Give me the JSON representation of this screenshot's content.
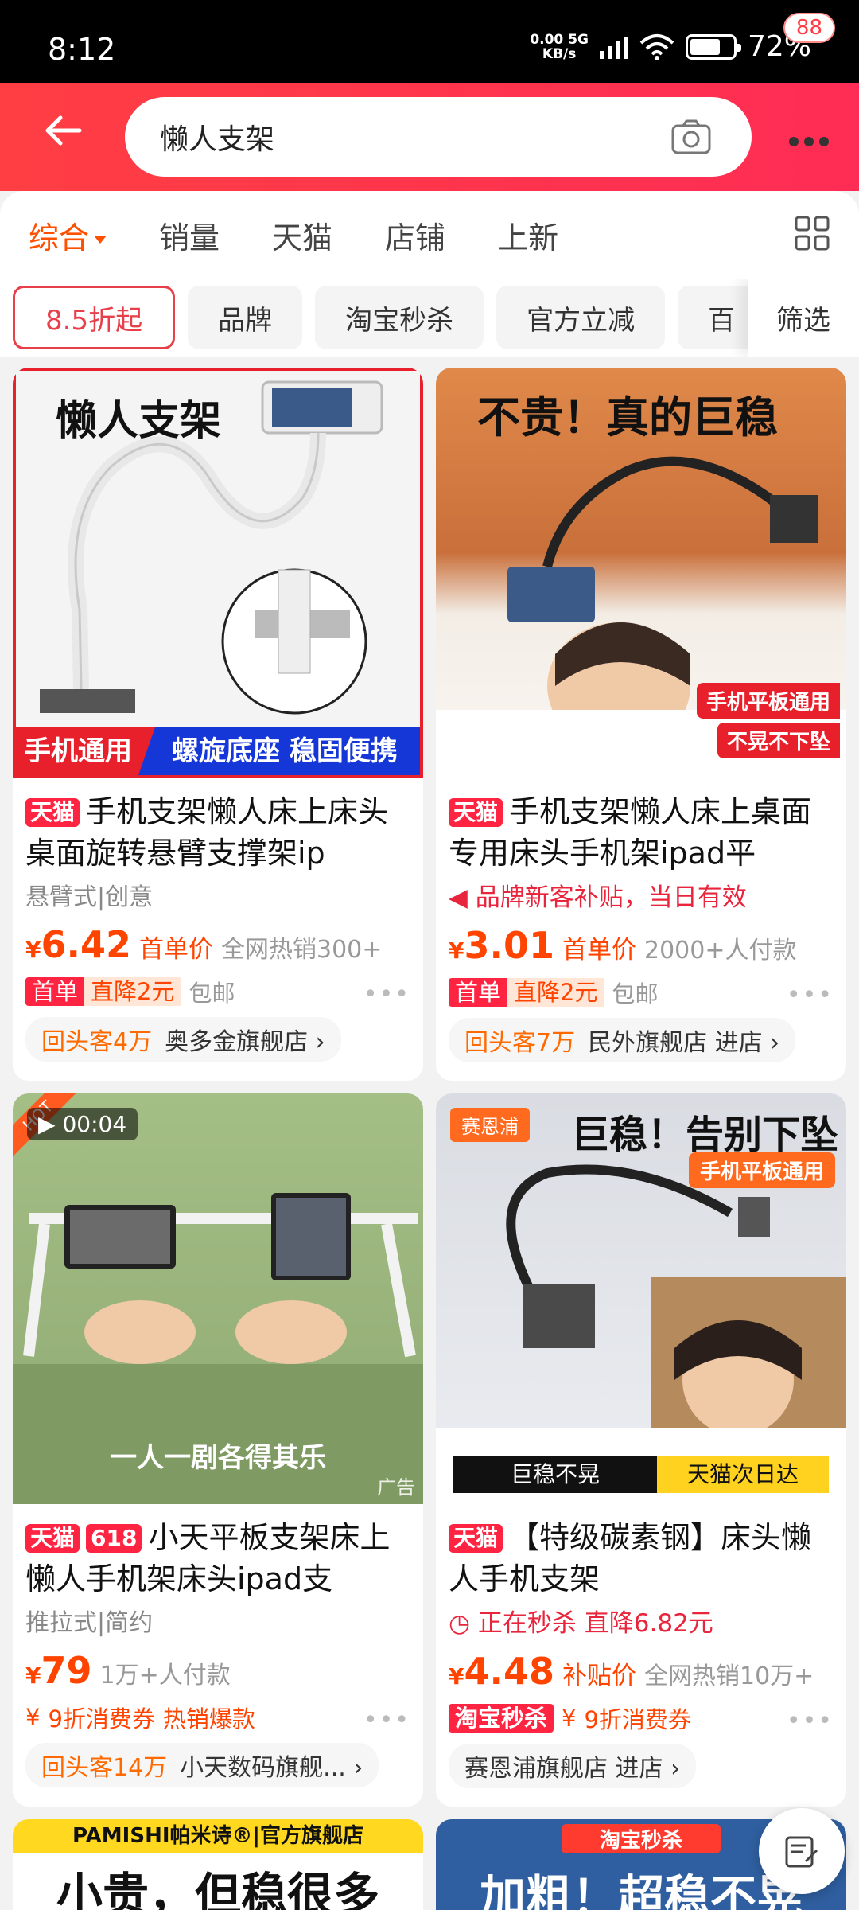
{
  "status": {
    "time": "8:12",
    "speed_top": "0.00",
    "speed_net": "5G",
    "speed_unit": "KB/s",
    "battery": "72%"
  },
  "search": {
    "query": "懒人支架",
    "cart_badge": "88"
  },
  "sort_tabs": [
    "综合",
    "销量",
    "天猫",
    "店铺",
    "上新"
  ],
  "filters": [
    "8.5折起",
    "品牌",
    "淘宝秒杀",
    "官方立减",
    "百"
  ],
  "filter_btn": "筛选",
  "products": [
    {
      "img_title": "懒人支架",
      "img_b1": "手机通用",
      "img_b2": "螺旋底座 稳固便携",
      "tag": "天猫",
      "title": "手机支架懒人床上床头桌面旋转悬臂支撑架ip",
      "sub": "悬臂式|创意",
      "price_sym": "¥",
      "price": "6.42",
      "price_label": "首单价",
      "sold": "全网热销300+",
      "t1": "首单",
      "t2": "直降2元",
      "ship": "包邮",
      "returning": "回头客4万",
      "shop": "奥多金旗舰店 ›"
    },
    {
      "img_title": "不贵！真的巨稳",
      "img_b1": "手机平板通用",
      "img_b2": "不晃不下坠",
      "tag": "天猫",
      "title": "手机支架懒人床上桌面专用床头手机架ipad平",
      "promo": "品牌新客补贴，当日有效",
      "price_sym": "¥",
      "price": "3.01",
      "price_label": "首单价",
      "sold": "2000+人付款",
      "t1": "首单",
      "t2": "直降2元",
      "ship": "包邮",
      "returning": "回头客7万",
      "shop": "民外旗舰店 进店 ›"
    },
    {
      "video_time": "00:04",
      "hot": "HOT",
      "img_caption": "一人一剧各得其乐",
      "ad": "广告",
      "tag": "天猫",
      "tag2": "618",
      "title": "小天平板支架床上懒人手机架床头ipad支",
      "sub": "推拉式|简约",
      "price_sym": "¥",
      "price": "79",
      "sold": "1万+人付款",
      "coupon": "9折消费券",
      "hot_label": "热销爆款",
      "returning": "回头客14万",
      "shop": "小天数码旗舰... ›"
    },
    {
      "brand": "赛恩浦",
      "img_title": "巨稳！告别下坠",
      "img_b1": "手机平板通用",
      "img_b2": "巨稳不晃",
      "img_b3": "天猫次日达",
      "tag": "天猫",
      "title": "【特级碳素钢】床头懒人手机支架",
      "flash": "正在秒杀  直降6.82元",
      "price_sym": "¥",
      "price": "4.48",
      "price_label": "补贴价",
      "sold": "全网热销10万+",
      "miaosha": "淘宝秒杀",
      "coupon": "9折消费券",
      "shop": "赛恩浦旗舰店 进店 ›"
    }
  ],
  "bottom": {
    "left_banner": "PAMISHI帕米诗®|官方旗舰店",
    "left_big": "小贵，但稳很多",
    "right_banner": "淘宝秒杀",
    "right_big": "加粗！超稳不晃"
  }
}
